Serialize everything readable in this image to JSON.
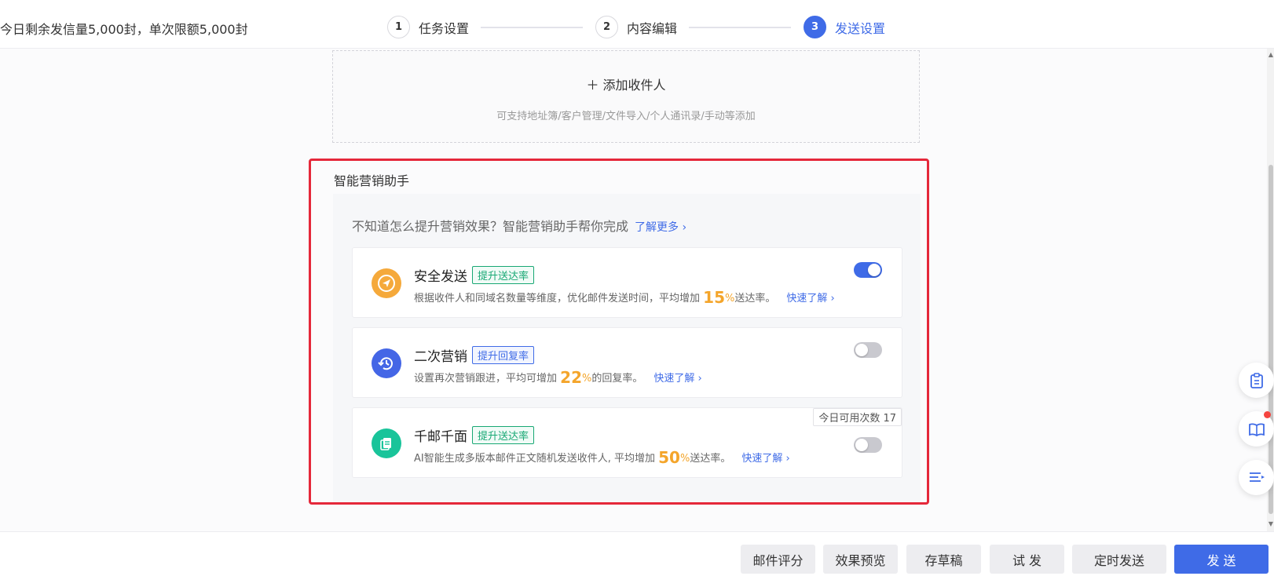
{
  "header": {
    "quota_text": "今日剩余发信量5,000封，单次限额5,000封",
    "steps": [
      {
        "num": "1",
        "label": "任务设置"
      },
      {
        "num": "2",
        "label": "内容编辑"
      },
      {
        "num": "3",
        "label": "发送设置",
        "active": true
      }
    ]
  },
  "recipients": {
    "add_label": "添加收件人",
    "hint": "可支持地址簿/客户管理/文件导入/个人通讯录/手动等添加"
  },
  "assistant": {
    "title": "智能营销助手",
    "desc": "不知道怎么提升营销效果？智能营销助手帮你完成",
    "more_link": "了解更多",
    "features": [
      {
        "name": "安全发送",
        "tag": "提升送达率",
        "text_before": "根据收件人和同域名数量等维度，优化邮件发送时间，平均增加",
        "percent": "15",
        "unit": "%",
        "text_after": "送达率。",
        "quick_link": "快速了解",
        "enabled": true,
        "icon": "send-icon",
        "icon_color": "#f5a93b"
      },
      {
        "name": "二次营销",
        "tag": "提升回复率",
        "text_before": "设置再次营销跟进，平均可增加",
        "percent": "22",
        "unit": "%",
        "text_after": "的回复率。",
        "quick_link": "快速了解",
        "enabled": false,
        "icon": "refresh-icon",
        "icon_color": "#4466e6"
      },
      {
        "name": "千邮千面",
        "tag": "提升送达率",
        "text_before": "AI智能生成多版本邮件正文随机发送收件人, 平均增加",
        "percent": "50",
        "unit": "%",
        "text_after": "送达率。",
        "quick_link": "快速了解",
        "enabled": false,
        "usage_text": "今日可用次数 17",
        "icon": "copy-icon",
        "icon_color": "#19c49a"
      }
    ]
  },
  "actions": {
    "score": "邮件评分",
    "preview": "效果预览",
    "draft": "存草稿",
    "test": "试 发",
    "schedule": "定时发送",
    "send": "发 送"
  },
  "colors": {
    "primary": "#3f6be7",
    "highlight": "#f4a52b",
    "tag_green": "#18a874",
    "annotation_red": "#e5283a"
  }
}
